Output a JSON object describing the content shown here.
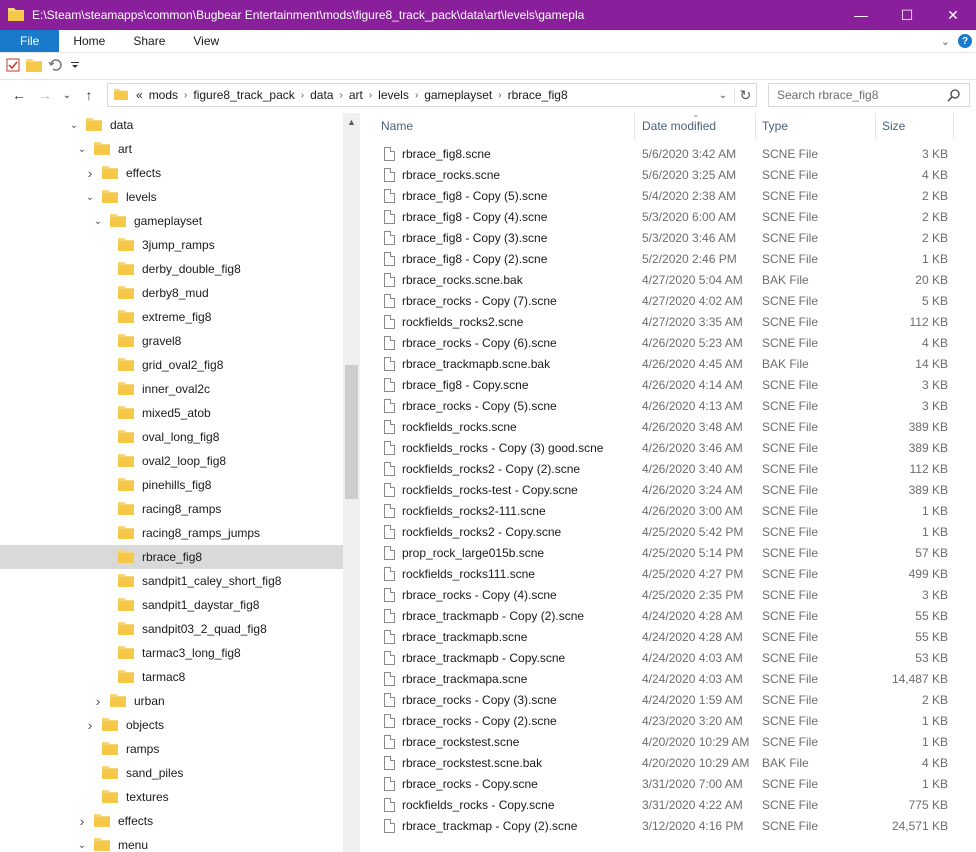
{
  "window": {
    "title": "E:\\Steam\\steamapps\\common\\Bugbear Entertainment\\mods\\figure8_track_pack\\data\\art\\levels\\gamepla",
    "minimize": "—",
    "maximize": "☐",
    "close": "✕"
  },
  "ribbon": {
    "tabs": [
      "File",
      "Home",
      "Share",
      "View"
    ],
    "expand": "⌄",
    "help": "?"
  },
  "nav": {
    "back": "←",
    "forward": "→",
    "recent": "⌄",
    "up": "↑",
    "overflow": "«",
    "breadcrumbs": [
      "mods",
      "figure8_track_pack",
      "data",
      "art",
      "levels",
      "gameplayset",
      "rbrace_fig8"
    ],
    "refresh": "↻",
    "search_placeholder": "Search rbrace_fig8"
  },
  "tree": [
    {
      "label": "data",
      "level": 0,
      "chev": "down"
    },
    {
      "label": "art",
      "level": 1,
      "chev": "down"
    },
    {
      "label": "effects",
      "level": 2,
      "chev": "right"
    },
    {
      "label": "levels",
      "level": 2,
      "chev": "down"
    },
    {
      "label": "gameplayset",
      "level": 3,
      "chev": "down"
    },
    {
      "label": "3jump_ramps",
      "level": 4,
      "chev": ""
    },
    {
      "label": "derby_double_fig8",
      "level": 4,
      "chev": ""
    },
    {
      "label": "derby8_mud",
      "level": 4,
      "chev": ""
    },
    {
      "label": "extreme_fig8",
      "level": 4,
      "chev": ""
    },
    {
      "label": "gravel8",
      "level": 4,
      "chev": ""
    },
    {
      "label": "grid_oval2_fig8",
      "level": 4,
      "chev": ""
    },
    {
      "label": "inner_oval2c",
      "level": 4,
      "chev": ""
    },
    {
      "label": "mixed5_atob",
      "level": 4,
      "chev": ""
    },
    {
      "label": "oval_long_fig8",
      "level": 4,
      "chev": ""
    },
    {
      "label": "oval2_loop_fig8",
      "level": 4,
      "chev": ""
    },
    {
      "label": "pinehills_fig8",
      "level": 4,
      "chev": ""
    },
    {
      "label": "racing8_ramps",
      "level": 4,
      "chev": ""
    },
    {
      "label": "racing8_ramps_jumps",
      "level": 4,
      "chev": ""
    },
    {
      "label": "rbrace_fig8",
      "level": 4,
      "chev": "",
      "selected": true
    },
    {
      "label": "sandpit1_caley_short_fig8",
      "level": 4,
      "chev": ""
    },
    {
      "label": "sandpit1_daystar_fig8",
      "level": 4,
      "chev": ""
    },
    {
      "label": "sandpit03_2_quad_fig8",
      "level": 4,
      "chev": ""
    },
    {
      "label": "tarmac3_long_fig8",
      "level": 4,
      "chev": ""
    },
    {
      "label": "tarmac8",
      "level": 4,
      "chev": ""
    },
    {
      "label": "urban",
      "level": 3,
      "chev": "right"
    },
    {
      "label": "objects",
      "level": 2,
      "chev": "right"
    },
    {
      "label": "ramps",
      "level": 2,
      "chev": ""
    },
    {
      "label": "sand_piles",
      "level": 2,
      "chev": ""
    },
    {
      "label": "textures",
      "level": 2,
      "chev": ""
    },
    {
      "label": "effects",
      "level": 1,
      "chev": "right"
    },
    {
      "label": "menu",
      "level": 1,
      "chev": "down"
    }
  ],
  "columns": [
    "Name",
    "Date modified",
    "Type",
    "Size"
  ],
  "sort_indicator": "⌄",
  "files": [
    {
      "name": "rbrace_fig8.scne",
      "date": "5/6/2020 3:42 AM",
      "type": "SCNE File",
      "size": "3 KB"
    },
    {
      "name": "rbrace_rocks.scne",
      "date": "5/6/2020 3:25 AM",
      "type": "SCNE File",
      "size": "4 KB"
    },
    {
      "name": "rbrace_fig8 - Copy (5).scne",
      "date": "5/4/2020 2:38 AM",
      "type": "SCNE File",
      "size": "2 KB"
    },
    {
      "name": "rbrace_fig8 - Copy (4).scne",
      "date": "5/3/2020 6:00 AM",
      "type": "SCNE File",
      "size": "2 KB"
    },
    {
      "name": "rbrace_fig8 - Copy (3).scne",
      "date": "5/3/2020 3:46 AM",
      "type": "SCNE File",
      "size": "2 KB"
    },
    {
      "name": "rbrace_fig8 - Copy (2).scne",
      "date": "5/2/2020 2:46 PM",
      "type": "SCNE File",
      "size": "1 KB"
    },
    {
      "name": "rbrace_rocks.scne.bak",
      "date": "4/27/2020 5:04 AM",
      "type": "BAK File",
      "size": "20 KB"
    },
    {
      "name": "rbrace_rocks - Copy (7).scne",
      "date": "4/27/2020 4:02 AM",
      "type": "SCNE File",
      "size": "5 KB"
    },
    {
      "name": "rockfields_rocks2.scne",
      "date": "4/27/2020 3:35 AM",
      "type": "SCNE File",
      "size": "112 KB"
    },
    {
      "name": "rbrace_rocks - Copy (6).scne",
      "date": "4/26/2020 5:23 AM",
      "type": "SCNE File",
      "size": "4 KB"
    },
    {
      "name": "rbrace_trackmapb.scne.bak",
      "date": "4/26/2020 4:45 AM",
      "type": "BAK File",
      "size": "14 KB"
    },
    {
      "name": "rbrace_fig8 - Copy.scne",
      "date": "4/26/2020 4:14 AM",
      "type": "SCNE File",
      "size": "3 KB"
    },
    {
      "name": "rbrace_rocks - Copy (5).scne",
      "date": "4/26/2020 4:13 AM",
      "type": "SCNE File",
      "size": "3 KB"
    },
    {
      "name": "rockfields_rocks.scne",
      "date": "4/26/2020 3:48 AM",
      "type": "SCNE File",
      "size": "389 KB"
    },
    {
      "name": "rockfields_rocks - Copy (3) good.scne",
      "date": "4/26/2020 3:46 AM",
      "type": "SCNE File",
      "size": "389 KB"
    },
    {
      "name": "rockfields_rocks2 - Copy (2).scne",
      "date": "4/26/2020 3:40 AM",
      "type": "SCNE File",
      "size": "112 KB"
    },
    {
      "name": "rockfields_rocks-test - Copy.scne",
      "date": "4/26/2020 3:24 AM",
      "type": "SCNE File",
      "size": "389 KB"
    },
    {
      "name": "rockfields_rocks2-111.scne",
      "date": "4/26/2020 3:00 AM",
      "type": "SCNE File",
      "size": "1 KB"
    },
    {
      "name": "rockfields_rocks2 - Copy.scne",
      "date": "4/25/2020 5:42 PM",
      "type": "SCNE File",
      "size": "1 KB"
    },
    {
      "name": "prop_rock_large015b.scne",
      "date": "4/25/2020 5:14 PM",
      "type": "SCNE File",
      "size": "57 KB"
    },
    {
      "name": "rockfields_rocks111.scne",
      "date": "4/25/2020 4:27 PM",
      "type": "SCNE File",
      "size": "499 KB"
    },
    {
      "name": "rbrace_rocks - Copy (4).scne",
      "date": "4/25/2020 2:35 PM",
      "type": "SCNE File",
      "size": "3 KB"
    },
    {
      "name": "rbrace_trackmapb - Copy (2).scne",
      "date": "4/24/2020 4:28 AM",
      "type": "SCNE File",
      "size": "55 KB"
    },
    {
      "name": "rbrace_trackmapb.scne",
      "date": "4/24/2020 4:28 AM",
      "type": "SCNE File",
      "size": "55 KB"
    },
    {
      "name": "rbrace_trackmapb - Copy.scne",
      "date": "4/24/2020 4:03 AM",
      "type": "SCNE File",
      "size": "53 KB"
    },
    {
      "name": "rbrace_trackmapa.scne",
      "date": "4/24/2020 4:03 AM",
      "type": "SCNE File",
      "size": "14,487 KB"
    },
    {
      "name": "rbrace_rocks - Copy (3).scne",
      "date": "4/24/2020 1:59 AM",
      "type": "SCNE File",
      "size": "2 KB"
    },
    {
      "name": "rbrace_rocks - Copy (2).scne",
      "date": "4/23/2020 3:20 AM",
      "type": "SCNE File",
      "size": "1 KB"
    },
    {
      "name": "rbrace_rockstest.scne",
      "date": "4/20/2020 10:29 AM",
      "type": "SCNE File",
      "size": "1 KB"
    },
    {
      "name": "rbrace_rockstest.scne.bak",
      "date": "4/20/2020 10:29 AM",
      "type": "BAK File",
      "size": "4 KB"
    },
    {
      "name": "rbrace_rocks - Copy.scne",
      "date": "3/31/2020 7:00 AM",
      "type": "SCNE File",
      "size": "1 KB"
    },
    {
      "name": "rockfields_rocks - Copy.scne",
      "date": "3/31/2020 4:22 AM",
      "type": "SCNE File",
      "size": "775 KB"
    },
    {
      "name": "rbrace_trackmap - Copy (2).scne",
      "date": "3/12/2020 4:16 PM",
      "type": "SCNE File",
      "size": "24,571 KB"
    }
  ],
  "colors": {
    "titlebar": "#8a1f9c",
    "file_tab": "#1979ca",
    "folder": "#f8d775",
    "selection": "#d9d9d9"
  }
}
